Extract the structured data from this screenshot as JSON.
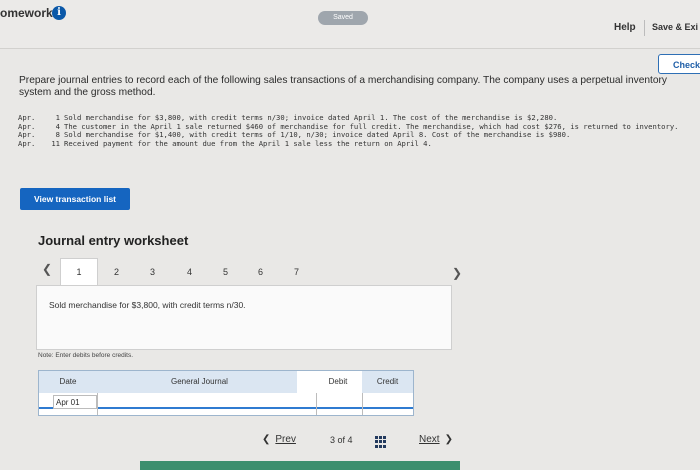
{
  "header": {
    "assignment_title": "omework",
    "info_icon": "info-icon",
    "saved_label": "Saved",
    "help_label": "Help",
    "save_exit_label": "Save & Exi",
    "check_label": "Check"
  },
  "prompt": "Prepare journal entries to record each of the following sales transactions of a merchandising company. The company uses a perpetual inventory system and the gross method.",
  "transactions": [
    {
      "date": "Apr.",
      "day": "1",
      "text": "Sold merchandise for $3,800, with credit terms n/30; invoice dated April 1. The cost of the merchandise is $2,280."
    },
    {
      "date": "Apr.",
      "day": "4",
      "text": "The customer in the April 1 sale returned $460 of merchandise for full credit. The merchandise, which had cost $276, is returned to inventory."
    },
    {
      "date": "Apr.",
      "day": "8",
      "text": "Sold merchandise for $1,400, with credit terms of 1/10, n/30; invoice dated April 8. Cost of the merchandise is $980."
    },
    {
      "date": "Apr.",
      "day": "11",
      "text": "Received payment for the amount due from the April 1 sale less the return on April 4."
    }
  ],
  "view_button_label": "View transaction list",
  "worksheet": {
    "title": "Journal entry worksheet",
    "tabs": [
      "1",
      "2",
      "3",
      "4",
      "5",
      "6",
      "7"
    ],
    "active_tab": "1",
    "description": "Sold merchandise for $3,800, with credit terms n/30.",
    "note": "Note: Enter debits before credits.",
    "columns": [
      "Date",
      "General Journal",
      "Debit",
      "Credit"
    ],
    "row_date": "Apr 01"
  },
  "pager": {
    "prev_label": "Prev",
    "position_label": "3 of 4",
    "next_label": "Next"
  },
  "colors": {
    "primary_blue": "#1565c0",
    "info_blue": "#0a58a8",
    "header_bg": "#dbe6f2"
  }
}
